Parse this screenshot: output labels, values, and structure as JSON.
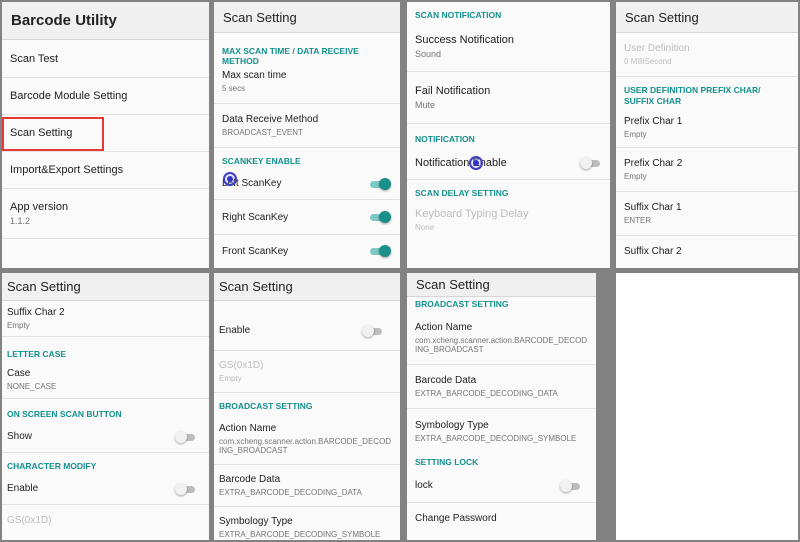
{
  "panel1": {
    "header": "Barcode Utility",
    "items": [
      {
        "title": "Scan Test"
      },
      {
        "title": "Barcode Module Setting"
      },
      {
        "title": "Scan Setting"
      },
      {
        "title": "Import&Export Settings"
      },
      {
        "title": "App version",
        "summary": "1.1.2"
      }
    ]
  },
  "panel2": {
    "header": "Scan Setting",
    "section1": "MAX SCAN TIME / DATA RECEIVE METHOD",
    "max_scan_title": "Max scan time",
    "max_scan_summary": "5 secs",
    "receive_title": "Data Receive Method",
    "receive_summary": "BROADCAST_EVENT",
    "section2": "SCANKEY ENABLE",
    "left_key": "Left ScanKey",
    "right_key": "Right ScanKey",
    "front_key": "Front ScanKey"
  },
  "panel3": {
    "section1": "SCAN NOTIFICATION",
    "success_title": "Success Notification",
    "success_summary": "Sound",
    "fail_title": "Fail Notification",
    "fail_summary": "Mute",
    "section2": "NOTIFICATION",
    "notif_enable": "Notification Enable",
    "section3": "SCAN DELAY SETTING",
    "delay_title": "Keyboard Typing Delay",
    "delay_summary": "None"
  },
  "panel4": {
    "header": "Scan Setting",
    "user_def_title": "User Definition",
    "user_def_summary": "0 MilliSecond",
    "section1": "USER DEFINITION PREFIX CHAR/ SUFFIX CHAR",
    "prefix1_title": "Prefix Char 1",
    "prefix1_summary": "Empty",
    "prefix2_title": "Prefix Char 2",
    "prefix2_summary": "Empty",
    "suffix1_title": "Suffix Char 1",
    "suffix1_summary": "ENTER",
    "suffix2_title": "Suffix Char 2"
  },
  "panel5": {
    "header": "Scan Setting",
    "suffix2_title": "Suffix Char 2",
    "suffix2_summary": "Empty",
    "section1": "LETTER CASE",
    "case_title": "Case",
    "case_summary": "NONE_CASE",
    "section2": "ON SCREEN SCAN BUTTON",
    "show_title": "Show",
    "section3": "CHARACTER MODIFY",
    "enable_title": "Enable",
    "gs_title": "GS(0x1D)"
  },
  "panel6": {
    "header": "Scan Setting",
    "enable_title": "Enable",
    "gs_title": "GS(0x1D)",
    "gs_summary": "Empty",
    "section1": "BROADCAST SETTING",
    "action_title": "Action Name",
    "action_summary": "com.xcheng.scanner.action.BARCODE_DECODING_BROADCAST",
    "barcode_title": "Barcode Data",
    "barcode_summary": "EXTRA_BARCODE_DECODING_DATA",
    "symbology_title": "Symbology Type",
    "symbology_summary": "EXTRA_BARCODE_DECODING_SYMBOLE"
  },
  "panel7": {
    "header": "Scan Setting",
    "section1": "BROADCAST SETTING",
    "action_title": "Action Name",
    "action_summary": "com.xcheng.scanner.action.BARCODE_DECODING_BROADCAST",
    "barcode_title": "Barcode Data",
    "barcode_summary": "EXTRA_BARCODE_DECODING_DATA",
    "symbology_title": "Symbology Type",
    "symbology_summary": "EXTRA_BARCODE_DECODING_SYMBOLE",
    "section2": "SETTING LOCK",
    "lock_title": "lock",
    "change_pw_title": "Change Password"
  },
  "switches": {
    "left_scankey": true,
    "right_scankey": true,
    "front_scankey": true,
    "notification_enable": false,
    "show_button": false,
    "character_modify_enable": false,
    "panel6_enable": false,
    "lock": false
  },
  "colors": {
    "accent": "#13908c",
    "highlight": "#e53935",
    "touch": "#3434c8"
  }
}
